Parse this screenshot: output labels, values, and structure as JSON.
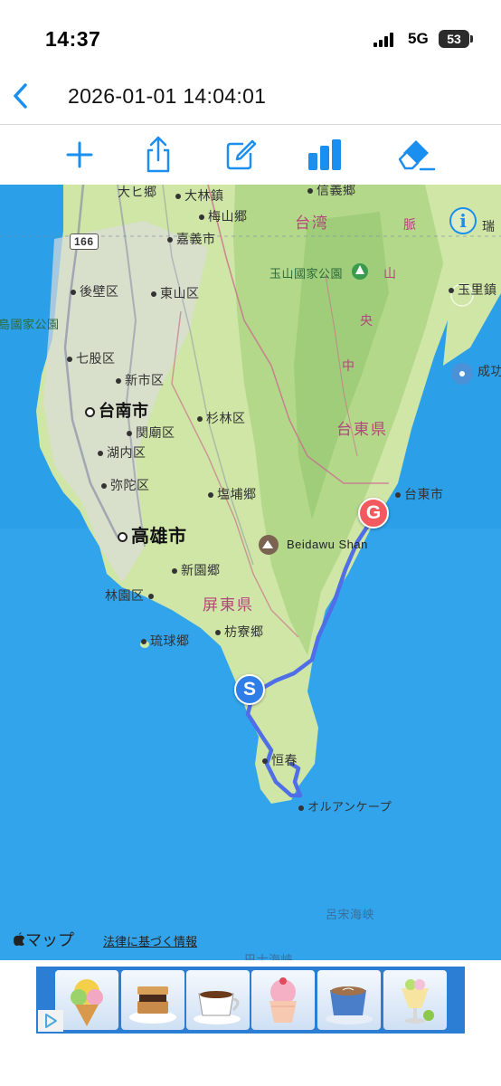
{
  "status": {
    "time": "14:37",
    "network": "5G",
    "battery": "53"
  },
  "nav": {
    "title": "2026-01-01 14:04:01"
  },
  "toolbar": {
    "buttons": [
      "plus-icon",
      "share-icon",
      "edit-icon",
      "chart-icon",
      "eraser-icon"
    ]
  },
  "map": {
    "labels": {
      "dahe": "大ヒ郷",
      "dalin": "大林鎮",
      "meishan": "梅山郷",
      "chiayi": "嘉義市",
      "xinyi": "信義郷",
      "taiwan": "台湾",
      "road166": "166",
      "yushan": "玉山國家公園",
      "houbi": "後壁区",
      "dongshan": "東山区",
      "npark": "島國家公園",
      "yuli": "玉里鎮",
      "ruisui": "瑞",
      "qigu": "七股区",
      "xinshi": "新市区",
      "tainan": "台南市",
      "guanmiao": "関廟区",
      "shanlin": "杉林区",
      "chenggong": "成功",
      "hunei": "湖内区",
      "mituo": "弥陀区",
      "taitung_county": "台東県",
      "yanpu": "塩埔郷",
      "taitung_city": "台東市",
      "kaohsiung": "高雄市",
      "beidawu": "Beidawu Shan",
      "xinyuan": "新園郷",
      "linyuan": "林園区",
      "pingtung": "屏東県",
      "fangliao": "枋寮郷",
      "liuqiu": "琉球郷",
      "hengchun": "恒春",
      "eluanbi": "オルアンケープ",
      "strait": "呂宋海峡",
      "mtn1": "中",
      "mtn2": "央",
      "mtn3": "山",
      "mtn4": "脈",
      "bottom_partial": "巴士海峡"
    },
    "markers": {
      "start": "S",
      "goal": "G"
    },
    "attribution": "マップ",
    "legal": "法律に基づく情報"
  },
  "ad": {
    "items": [
      "ice-cream-cone",
      "smores",
      "coffee-cup",
      "cupcake",
      "latte",
      "parfait"
    ]
  },
  "colors": {
    "accent": "#1a8ff0",
    "route": "#4f6ee8",
    "start": "#2f7de6",
    "goal": "#f25a5f",
    "sea": "#2b9fe8",
    "land": "#cde8a8"
  }
}
